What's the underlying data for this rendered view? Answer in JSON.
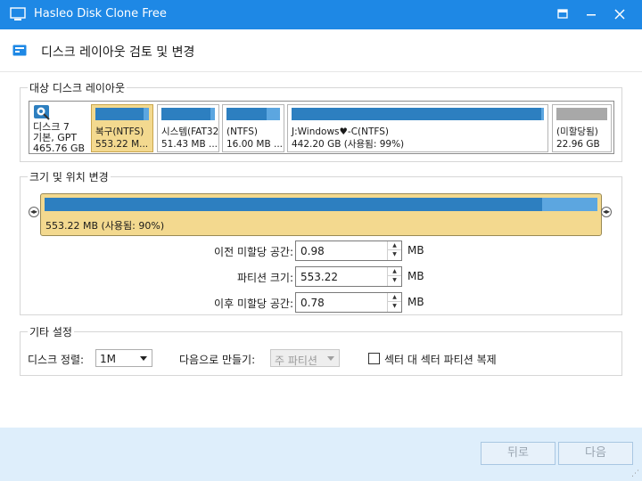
{
  "window": {
    "title": "Hasleo Disk Clone Free"
  },
  "header": {
    "title": "디스크 레이아웃 검토 및 변경"
  },
  "layout_group": {
    "title": "대상 디스크 레이아웃",
    "disk": {
      "name": "디스크 7",
      "type": "기본, GPT",
      "size": "465.76 GB"
    },
    "partitions": [
      {
        "name": "복구(NTFS)",
        "size": "553.22 M...",
        "used_pct": 90,
        "selected": true,
        "bar_color": "blue"
      },
      {
        "name": "시스템(FAT32",
        "size": "51.43 MB ...",
        "used_pct": 92,
        "selected": false,
        "bar_color": "blue"
      },
      {
        "name": "(NTFS)",
        "size": "16.00 MB ...",
        "used_pct": 75,
        "selected": false,
        "bar_color": "blue"
      },
      {
        "name": "J:Windows♥-C(NTFS)",
        "size": "442.20 GB (사용됨: 99%)",
        "used_pct": 99,
        "selected": false,
        "bar_color": "blue"
      },
      {
        "name": "(미할당됨)",
        "size": "22.96 GB",
        "used_pct": 100,
        "selected": false,
        "bar_color": "gray"
      }
    ]
  },
  "resize_group": {
    "title": "크기 및 위치 변경",
    "bar_label": "553.22 MB (사용됨: 90%)",
    "used_pct": 90,
    "fields": [
      {
        "label": "이전 미할당 공간:",
        "value": "0.98",
        "unit": "MB"
      },
      {
        "label": "파티션 크기:",
        "value": "553.22",
        "unit": "MB"
      },
      {
        "label": "이후 미할당 공간:",
        "value": "0.78",
        "unit": "MB"
      }
    ]
  },
  "other_group": {
    "title": "기타 설정",
    "align_label": "디스크 정렬:",
    "align_value": "1M",
    "create_as_label": "다음으로 만들기:",
    "create_as_value": "주 파티션",
    "sector_label": "섹터 대 섹터 파티션 복제"
  },
  "footer": {
    "back_label": "뒤로",
    "next_label": "다음"
  },
  "colors": {
    "titlebar": "#1e88e5",
    "partition_selected": "#f3d98f",
    "bar_used": "#2d7fc0",
    "bar_free": "#5ca6e0",
    "footer": "#deeefb"
  }
}
